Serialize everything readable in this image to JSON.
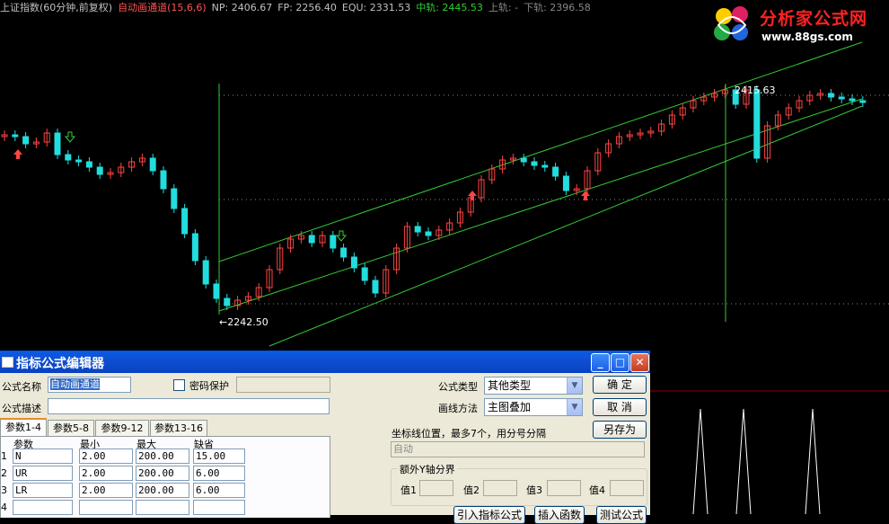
{
  "topbar": {
    "instrument": "上证指数(60分钟,前复权)",
    "indicator": "自动画通道(15,6,6)",
    "np": "NP: 2406.67",
    "fp": "FP: 2256.40",
    "equ": "EQU: 2331.53",
    "mid": "中轨: 2445.53",
    "upper": "上轨: -",
    "lower": "下轨: 2396.58"
  },
  "logo": {
    "title": "分析家公式网",
    "url": "www.88gs.com"
  },
  "labels": {
    "high": "2415.63",
    "low": "←2242.50"
  },
  "colors": {
    "up": "#ff4444",
    "down": "#22dddd",
    "channel": "#33cc33",
    "dialog_title": "#0a5be4"
  },
  "dialog": {
    "title": "指标公式编辑器",
    "name_label": "公式名称",
    "name_value": "自动画通道",
    "protect_label": "密码保护",
    "desc_label": "公式描述",
    "type_label": "公式类型",
    "type_value": "其他类型",
    "draw_label": "画线方法",
    "draw_value": "主图叠加",
    "ok": "确  定",
    "cancel": "取  消",
    "save_as": "另存为",
    "coord_label": "坐标线位置，最多7个，用分号分隔",
    "coord_value": "自动",
    "yaxis_group": "额外Y轴分界",
    "y_labels": [
      "值1",
      "值2",
      "值3",
      "值4"
    ],
    "tabs": [
      "参数1-4",
      "参数5-8",
      "参数9-12",
      "参数13-16"
    ],
    "headers": [
      "参数",
      "最小",
      "最大",
      "缺省"
    ],
    "rows": [
      {
        "no": "1",
        "name": "N",
        "min": "2.00",
        "max": "200.00",
        "def": "15.00"
      },
      {
        "no": "2",
        "name": "UR",
        "min": "2.00",
        "max": "200.00",
        "def": "6.00"
      },
      {
        "no": "3",
        "name": "LR",
        "min": "2.00",
        "max": "200.00",
        "def": "6.00"
      },
      {
        "no": "4",
        "name": "",
        "min": "",
        "max": "",
        "def": ""
      }
    ],
    "bottom_buttons": [
      "引入指标公式",
      "插入函数",
      "测试公式"
    ]
  }
}
